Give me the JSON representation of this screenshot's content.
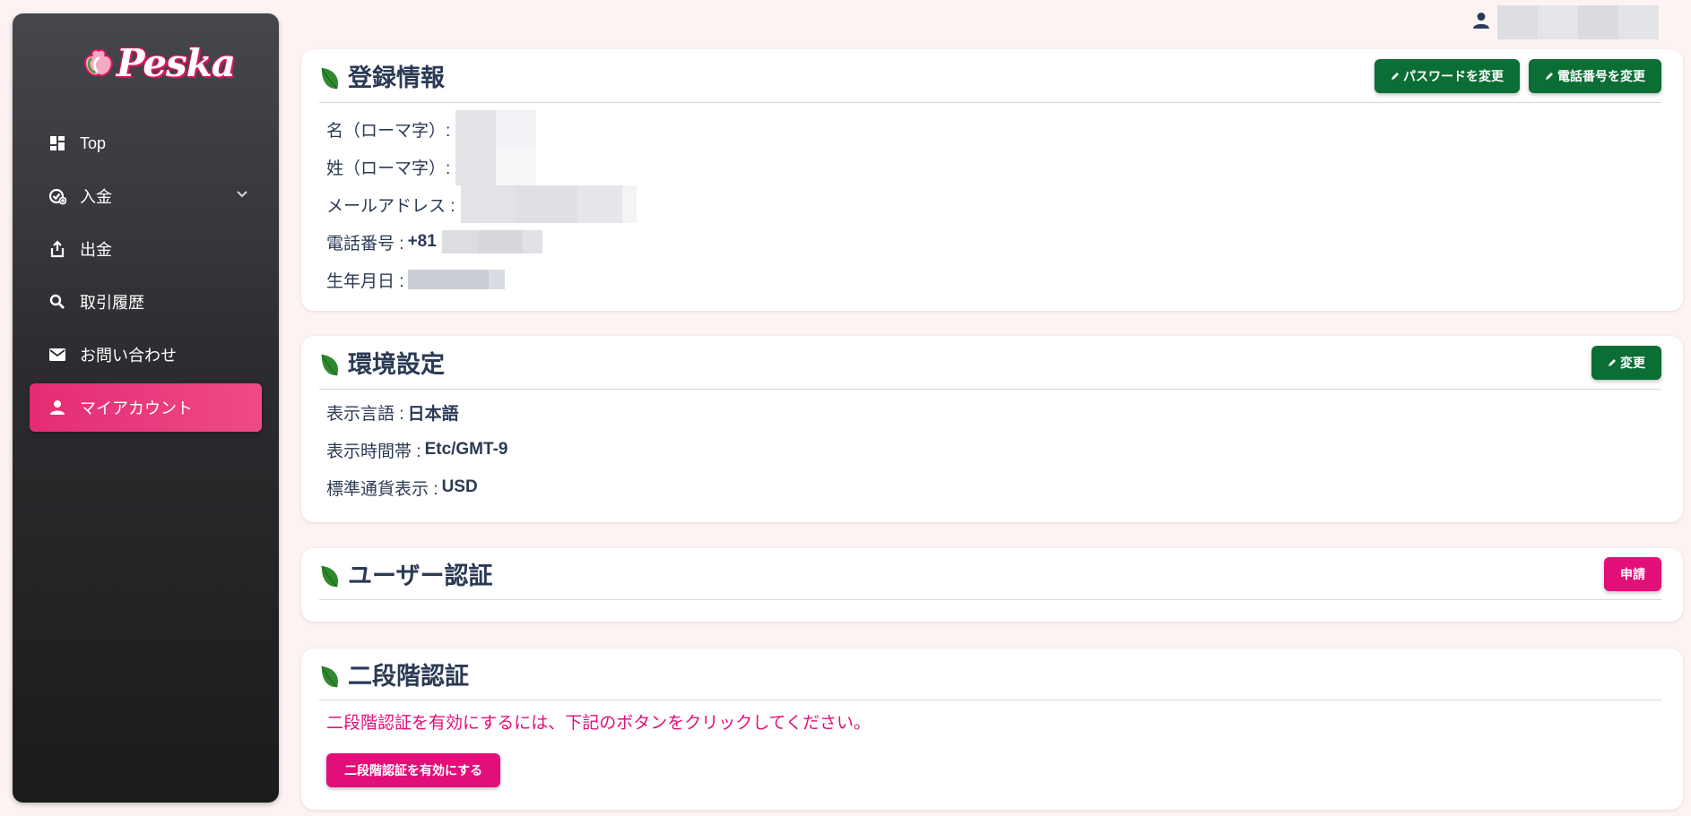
{
  "brand": {
    "name": "Peska"
  },
  "sidebar": {
    "items": [
      {
        "label": "Top",
        "icon": "dashboard-icon"
      },
      {
        "label": "入金",
        "icon": "deposit-icon",
        "expandable": true
      },
      {
        "label": "出金",
        "icon": "withdraw-icon"
      },
      {
        "label": "取引履歴",
        "icon": "search-icon"
      },
      {
        "label": "お問い合わせ",
        "icon": "mail-icon"
      },
      {
        "label": "マイアカウント",
        "icon": "user-icon",
        "active": true
      }
    ]
  },
  "registration": {
    "title": "登録情報",
    "buttons": {
      "change_password": "パスワードを変更",
      "change_phone": "電話番号を変更"
    },
    "fields": {
      "first_name_label": "名（ローマ字）:",
      "last_name_label": "姓（ローマ字）:",
      "email_label": "メールアドレス :",
      "phone_label": "電話番号 :",
      "phone_prefix": "+81",
      "birthday_label": "生年月日 :"
    }
  },
  "environment": {
    "title": "環境設定",
    "change_button": "変更",
    "fields": {
      "language_label": "表示言語 :",
      "language_value": "日本語",
      "timezone_label": "表示時間帯 :",
      "timezone_value": "Etc/GMT-9",
      "currency_label": "標準通貨表示 :",
      "currency_value": "USD"
    }
  },
  "user_verification": {
    "title": "ユーザー認証",
    "apply_button": "申請"
  },
  "two_factor": {
    "title": "二段階認証",
    "message": "二段階認証を有効にするには、下記のボタンをクリックしてください。",
    "enable_button": "二段階認証を有効にする"
  },
  "colors": {
    "accent_pink": "#e20e7a",
    "active_nav": "#e42c74",
    "button_green": "#0b6e35",
    "leaf_green": "#2f8a2f",
    "title_navy": "#2b3a55",
    "page_background": "#fdf3f3"
  }
}
